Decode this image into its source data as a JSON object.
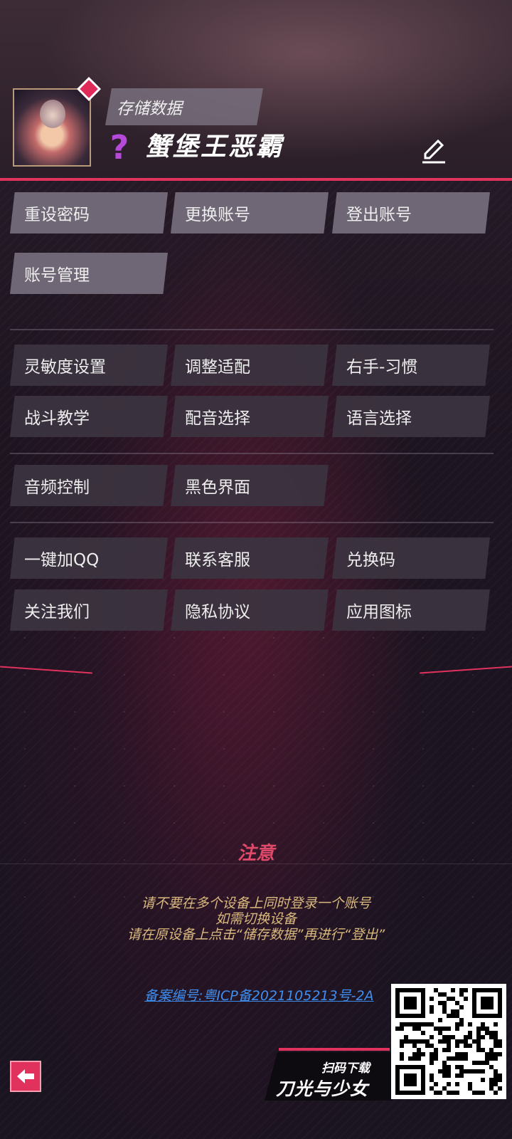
{
  "header": {
    "save_label": "存储数据",
    "username": "蟹堡王恶霸",
    "level_icon": "question-mark-icon",
    "edit_icon": "pencil-icon"
  },
  "account_buttons": [
    "重设密码",
    "更换账号",
    "登出账号",
    "账号管理"
  ],
  "settings_buttons": [
    "灵敏度设置",
    "调整适配",
    "右手-习惯",
    "战斗教学",
    "配音选择",
    "语言选择"
  ],
  "display_buttons": [
    "音频控制",
    "黑色界面"
  ],
  "social_buttons": [
    "一键加QQ",
    "联系客服",
    "兑换码",
    "关注我们",
    "隐私协议",
    "应用图标"
  ],
  "notice": {
    "title": "注意",
    "lines": [
      "请不要在多个设备上同时登录一个账号",
      "如需切换设备",
      "请在原设备上点击“储存数据”再进行“登出”"
    ]
  },
  "icp": "备案编号:粤ICP备2021105213号-2A",
  "promo": {
    "small": "扫码下载",
    "big": "刀光与少女"
  },
  "back_icon": "back-arrow-icon",
  "colors": {
    "accent": "#e0325c",
    "notice_text": "#d9b97e",
    "link": "#3e8ef0"
  }
}
